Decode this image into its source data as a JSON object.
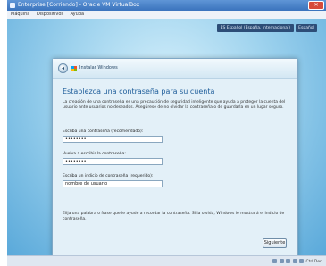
{
  "vm": {
    "title": "Enterprise [Corriendo] - Oracle VM VirtualBox",
    "close_label": "✕",
    "menu": [
      "Máquina",
      "Dispositivos",
      "Ayuda"
    ],
    "host_key": "Ctrl Der."
  },
  "guest": {
    "language_bar": "ES Español (España, internacional)",
    "language_button": "Español"
  },
  "dialog": {
    "title": "Instalar Windows",
    "heading": "Establezca una contraseña para su cuenta",
    "description": "La creación de una contraseña es una precaución de seguridad inteligente que ayuda a proteger la cuenta del usuario ante usuarios no deseados. Asegúrese de no olvidar la contraseña o de guardarla en un lugar seguro.",
    "password_label": "Escriba una contraseña (recomendado):",
    "password_value": "••••••••",
    "confirm_label": "Vuelva a escribir la contraseña:",
    "confirm_value": "••••••••",
    "hint_label": "Escriba un indicio de contraseña (requerido):",
    "hint_value": "nombre de usuario",
    "help_text": "Elija una palabra o frase que le ayude a recordar la contraseña. Si la olvida, Windows le mostrará el indicio de contraseña.",
    "next_button": "Siguiente"
  },
  "status": {
    "host_key": "Ctrl Der."
  }
}
